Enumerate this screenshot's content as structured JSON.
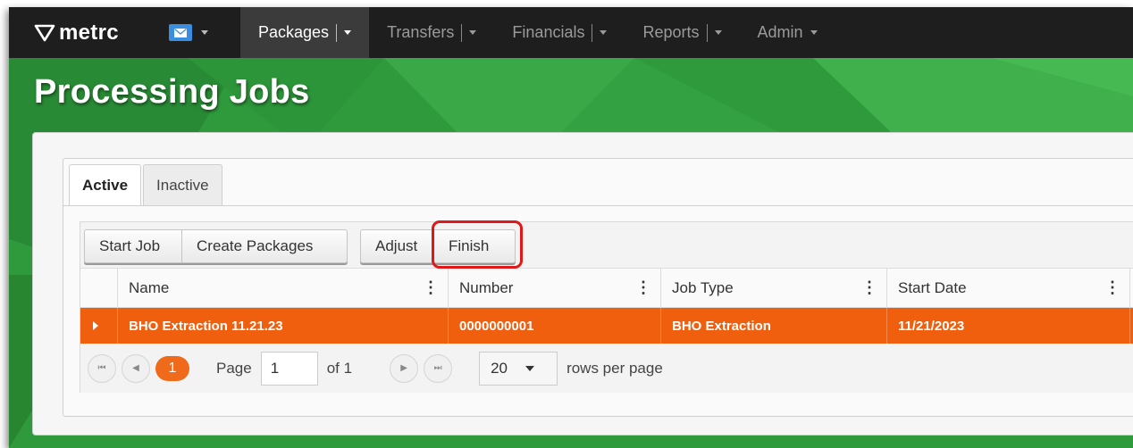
{
  "brand": {
    "name": "metrc",
    "logo_icon": "metrc-logo-icon"
  },
  "navbar": {
    "mail_icon": "envelope-icon",
    "items": [
      {
        "label": "Packages",
        "active": true
      },
      {
        "label": "Transfers",
        "active": false
      },
      {
        "label": "Financials",
        "active": false
      },
      {
        "label": "Reports",
        "active": false
      },
      {
        "label": "Admin",
        "active": false
      }
    ]
  },
  "page": {
    "title": "Processing Jobs"
  },
  "tabs": [
    {
      "label": "Active",
      "active": true
    },
    {
      "label": "Inactive",
      "active": false
    }
  ],
  "toolbar": {
    "start_job": "Start Job",
    "create_packages": "Create Packages",
    "adjust": "Adjust",
    "finish": "Finish"
  },
  "table": {
    "columns": [
      "Name",
      "Number",
      "Job Type",
      "Start Date"
    ],
    "rows": [
      {
        "name": "BHO Extraction 11.21.23",
        "number": "0000000001",
        "job_type": "BHO Extraction",
        "start_date": "11/21/2023"
      }
    ]
  },
  "pager": {
    "current_page_badge": "1",
    "page_label": "Page",
    "page_value": "1",
    "of_label": "of 1",
    "rows_per_page_value": "20",
    "rows_per_page_label": "rows per page"
  },
  "colors": {
    "navbar": "#1e1e1e",
    "background_green": "#2f9a3c",
    "selected_row": "#ef5f0e",
    "highlight_border": "#e01818"
  }
}
